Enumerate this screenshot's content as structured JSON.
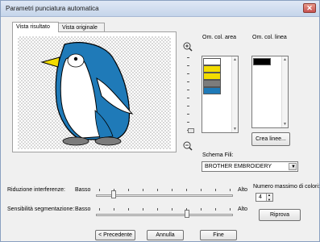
{
  "window": {
    "title": "Parametri punciatura automatica",
    "close_glyph": "✕"
  },
  "tabs": [
    {
      "label": "Vista risultato",
      "active": true
    },
    {
      "label": "Vista originale",
      "active": false
    }
  ],
  "preview": {
    "image": "penguin-illustration",
    "colors": {
      "blue": "#1f7ab8",
      "yellow": "#f2dc00",
      "gray": "#7c7c7c",
      "white": "#ffffff"
    }
  },
  "zoom": {
    "in_icon": "zoom-in-icon",
    "out_icon": "zoom-out-icon"
  },
  "area_colors": {
    "header": "Om. col. area",
    "swatches": [
      "#ffffff",
      "#f2dc00",
      "#f2dc00",
      "#7c7c7c",
      "#1f7ab8"
    ]
  },
  "line_colors": {
    "header": "Om. col. linea",
    "swatches": [
      "#000000"
    ]
  },
  "crea_button": "Crea linee...",
  "thread_scheme": {
    "label": "Schema Fili:",
    "value": "BROTHER EMBROIDERY"
  },
  "noise": {
    "label": "Riduzione interferenze:",
    "low": "Basso",
    "high": "Alto",
    "position": 0.12
  },
  "segmentation": {
    "label": "Sensibilità segmentazione:",
    "low": "Basso",
    "high": "Alto",
    "position": 0.72
  },
  "max_colors": {
    "label": "Numero massimo di colori:",
    "value": "4"
  },
  "retry_button": "Riprova",
  "footer": {
    "back": "< Precedente",
    "cancel": "Annulla",
    "finish": "Fine"
  }
}
